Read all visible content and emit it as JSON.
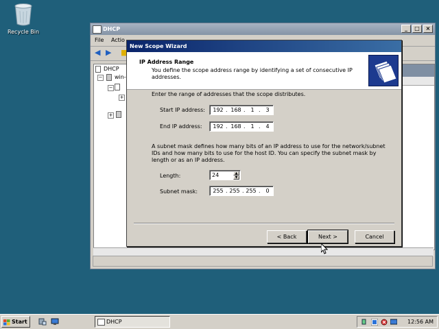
{
  "desktop": {
    "recycle_bin_label": "Recycle Bin"
  },
  "dhcp_window": {
    "title": "DHCP",
    "menu": [
      "File",
      "Actio"
    ],
    "tree": {
      "root": "DHCP",
      "server": "win-"
    }
  },
  "wizard": {
    "title": "New Scope Wizard",
    "heading": "IP Address Range",
    "subheading": "You define the scope address range by identifying a set of consecutive IP addresses.",
    "intro": "Enter the range of addresses that the scope distributes.",
    "start_label": "Start IP address:",
    "start_ip": [
      "192",
      "168",
      "1",
      "3"
    ],
    "end_label": "End IP address:",
    "end_ip": [
      "192",
      "168",
      "1",
      "4"
    ],
    "mask_paragraph": "A subnet mask defines how many bits of an IP address to use for the network/subnet IDs and how many bits to use for the host ID. You can specify the subnet mask by length or as an IP address.",
    "length_label": "Length:",
    "length_value": "24",
    "mask_label": "Subnet mask:",
    "mask_ip": [
      "255",
      "255",
      "255",
      "0"
    ],
    "buttons": {
      "back": "< Back",
      "next": "Next >",
      "cancel": "Cancel"
    }
  },
  "taskbar": {
    "start_label": "Start",
    "tasks": [
      {
        "label": "DHCP"
      }
    ],
    "clock": "12:56 AM"
  },
  "colors": {
    "desktop": "#1f5f7a",
    "title_active": "#0a246a",
    "title_inactive": "#8594a6"
  },
  "icons": [
    "recycle-bin-icon",
    "windows-flag-icon",
    "dhcp-icon",
    "wizard-logo-icon",
    "back-arrow-icon",
    "forward-arrow-icon"
  ]
}
